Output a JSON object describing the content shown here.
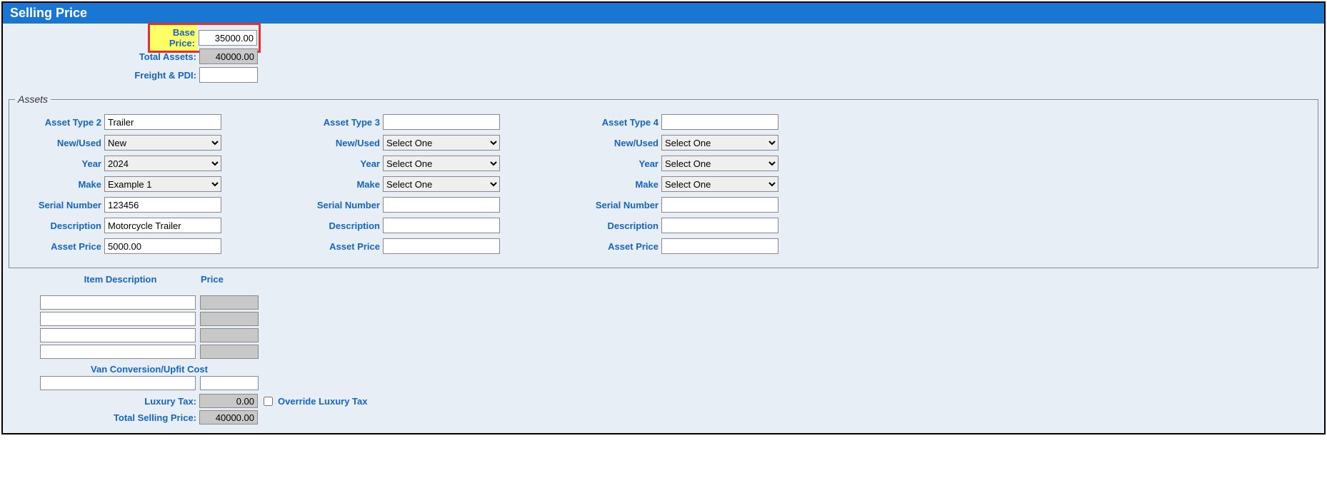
{
  "panel_title": "Selling Price",
  "top": {
    "base_price_label": "Base Price:",
    "base_price_value": "35000.00",
    "total_assets_label": "Total Assets:",
    "total_assets_value": "40000.00",
    "freight_pdi_label": "Freight & PDI:",
    "freight_pdi_value": ""
  },
  "fieldset_legend": "Assets",
  "field_labels": {
    "asset_type": "Asset Type",
    "new_used": "New/Used",
    "year": "Year",
    "make": "Make",
    "serial_number": "Serial Number",
    "description": "Description",
    "asset_price": "Asset Price"
  },
  "select_placeholder": "Select One",
  "assets": [
    {
      "col_num": "2",
      "asset_type": "Trailer",
      "new_used": "New",
      "year": "2024",
      "make": "Example 1",
      "serial_number": "123456",
      "description": "Motorcycle Trailer",
      "asset_price": "5000.00"
    },
    {
      "col_num": "3",
      "asset_type": "",
      "new_used": "Select One",
      "year": "Select One",
      "make": "Select One",
      "serial_number": "",
      "description": "",
      "asset_price": ""
    },
    {
      "col_num": "4",
      "asset_type": "",
      "new_used": "Select One",
      "year": "Select One",
      "make": "Select One",
      "serial_number": "",
      "description": "",
      "asset_price": ""
    }
  ],
  "items": {
    "header_desc": "Item Description",
    "header_price": "Price",
    "rows": [
      {
        "desc": "",
        "price": ""
      },
      {
        "desc": "",
        "price": ""
      },
      {
        "desc": "",
        "price": ""
      },
      {
        "desc": "",
        "price": ""
      }
    ],
    "van_label": "Van Conversion/Upfit Cost",
    "van_desc": "",
    "van_price": ""
  },
  "bottom": {
    "luxury_tax_label": "Luxury Tax:",
    "luxury_tax_value": "0.00",
    "override_label": "Override Luxury Tax",
    "total_selling_label": "Total Selling Price:",
    "total_selling_value": "40000.00"
  }
}
